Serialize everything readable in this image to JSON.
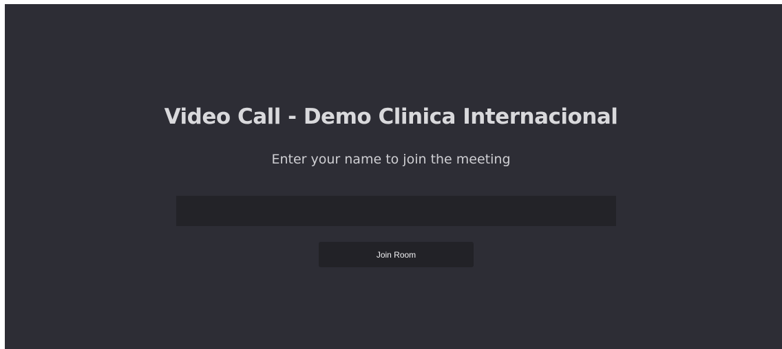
{
  "page": {
    "title": "Video Call - Demo Clinica Internacional",
    "subtitle": "Enter your name to join the meeting"
  },
  "form": {
    "name_value": "",
    "name_placeholder": "",
    "join_label": "Join Room"
  },
  "colors": {
    "background": "#2d2d35",
    "input_background": "#232328",
    "button_background": "#222227",
    "text": "#d9d9dc"
  }
}
